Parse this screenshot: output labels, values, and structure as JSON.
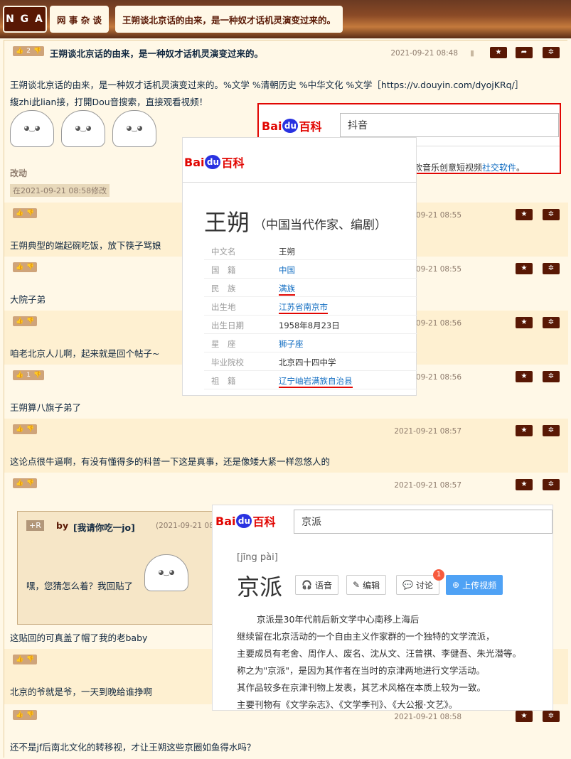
{
  "nav": {
    "logo": "N G A",
    "forum": "网 事 杂 谈",
    "topic": "王朔谈北京话的由来，是一种奴才话机灵演变过来的。"
  },
  "colors": {
    "brand": "#591804",
    "bg": "#fff8e7",
    "alt_bg": "#fef0d1",
    "baidu_red": "#e10602"
  },
  "op": {
    "votes": "2",
    "title": "王朔谈北京话的由来，是一种奴才话机灵演变过来的。",
    "date": "2021-09-21 08:48",
    "body1": "王朔谈北京话的由来，是一种奴才话机灵演变过来的。%文学 %清朝历史 %中华文化 %文学［https://v.douyin.com/dyojKRq/］",
    "body2": "緮zhi此lian接，打開Dou音搜索，直接观看视频！",
    "edited": "改动",
    "edit_badge": "在2021-09-21 08:58修改"
  },
  "replies": [
    {
      "date": "2021-09-21 08:55",
      "text": "王朔典型的端起碗吃饭，放下筷子骂娘"
    },
    {
      "date": "2021-09-21 08:55",
      "text": "大院子弟"
    },
    {
      "date": "2021-09-21 08:56",
      "text": "咱老北京人儿啊，起来就是回个帖子~"
    },
    {
      "date": "2021-09-21 08:56",
      "votes": "1",
      "text": "王朔算八旗子弟了"
    },
    {
      "date": "2021-09-21 08:57",
      "text": "这论点很牛逼啊，有没有懂得多的科普一下这是真事，还是像矮大紧一样忽悠人的"
    },
    {
      "date": "2021-09-21 08:57",
      "text": "这贴回的可真盖了帽了我的老baby"
    },
    {
      "date": "",
      "text": "北京的爷就是爷，一天到晚给谁挣啊"
    },
    {
      "date": "2021-09-21 08:58",
      "text": "还不是jf后南北文化的转移视，才让王朔这些京圈如鱼得水吗？"
    }
  ],
  "quote": {
    "tag": "R",
    "by": "by",
    "user": "[我请你吃一jo]",
    "date": "(2021-09-21 08",
    "text": "嘿，您猜怎么着？我回贴了"
  },
  "baidu_douyin": {
    "logo_a": "Bai",
    "logo_du": "du",
    "logo_b": "百科",
    "query": "抖音",
    "snippet": "抖音，是由字节跳动孵化的一款音乐创意短视频",
    "link": "社交软件",
    "end": "。"
  },
  "baidu_wangshuo": {
    "logo_a": "Bai",
    "logo_du": "du",
    "logo_b": "百科",
    "name": "王朔",
    "desc": "（中国当代作家、编剧）",
    "rows": [
      {
        "k": "中文名",
        "v": "王朔"
      },
      {
        "k": "国　籍",
        "v": "中国"
      },
      {
        "k": "民　族",
        "v": "满族"
      },
      {
        "k": "出生地",
        "v": "江苏省南京市"
      },
      {
        "k": "出生日期",
        "v": "1958年8月23日"
      },
      {
        "k": "星　座",
        "v": "狮子座"
      },
      {
        "k": "毕业院校",
        "v": "北京四十四中学"
      },
      {
        "k": "祖　籍",
        "v": "辽宁岫岩满族自治县"
      }
    ]
  },
  "baidu_jingpai": {
    "logo_a": "Bai",
    "logo_du": "du",
    "logo_b": "百科",
    "query": "京派",
    "pinyin": "[jīng pài]",
    "title": "京派",
    "btn_voice": "语音",
    "btn_edit": "编辑",
    "btn_discuss": "讨论",
    "discuss_count": "1",
    "btn_upload": "上传视频",
    "lines": [
      "京派是30年代前后新文学中心南移上海后",
      "继续留在北京活动的一个自由主义作家群的一个独特的文学流派，",
      "主要成员有老舍、周作人、废名、沈从文、汪曾祺、李健吾、朱光潜等。",
      "称之为\"京派\"，是因为其作者在当时的京津两地进行文学活动。",
      "其作品较多在京津刊物上发表，其艺术风格在本质上较为一致。",
      "主要刊物有《文学杂志》、《文学季刊》、《大公报·文艺》。"
    ]
  }
}
